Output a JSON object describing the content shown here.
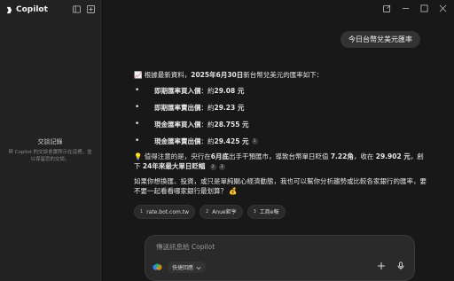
{
  "sidebar": {
    "brand": "Copilot",
    "empty_title": "交談記錄",
    "empty_text": "與 Copilot 的交談會實際示在這裡，並 以保留您的交談。"
  },
  "conversation": {
    "user_message": "今日台幣兌美元匯率",
    "response": {
      "intro_emoji": "📈",
      "intro_prefix": "根據最新資料，",
      "intro_date": "2025年6月30日",
      "intro_suffix": "新台幣兌美元的匯率如下：",
      "bullets": [
        {
          "label": "即期匯率買入價",
          "sep": "：約 ",
          "value": "29.08 元",
          "cite": ""
        },
        {
          "label": "即期匯率賣出價",
          "sep": "：約 ",
          "value": "29.23 元",
          "cite": ""
        },
        {
          "label": "現金匯率買入價",
          "sep": "：約 ",
          "value": "28.755 元",
          "cite": ""
        },
        {
          "label": "現金匯率賣出價",
          "sep": "：約 ",
          "value": "29.425 元",
          "cite": "1"
        }
      ],
      "note_emoji": "💡",
      "note_part1": "值得注意的是，央行在",
      "note_bold1": "6月底",
      "note_part2": "出手干預匯市，導致台幣單日貶值 ",
      "note_bold2": "7.22角",
      "note_part3": "，收在 ",
      "note_bold3": "29.902 元",
      "note_part4": "，創下 ",
      "note_bold4": "24年來最大單日貶幅",
      "note_cites": [
        "2",
        "3"
      ],
      "closing": "如果你想換匯、投資，或只是單純關心經濟動態，我也可以幫你分析趨勢或比較各家銀行的匯率，要不要一起看看哪家銀行最划算？",
      "closing_emoji": "💰"
    },
    "sources": [
      {
        "num": "1",
        "label": "rate.bot.com.tw"
      },
      {
        "num": "2",
        "label": "Anue鉅亨"
      },
      {
        "num": "3",
        "label": "工商e報"
      }
    ]
  },
  "composer": {
    "placeholder": "傳送訊息給 Copilot",
    "quick_reply_label": "快捷回應"
  }
}
